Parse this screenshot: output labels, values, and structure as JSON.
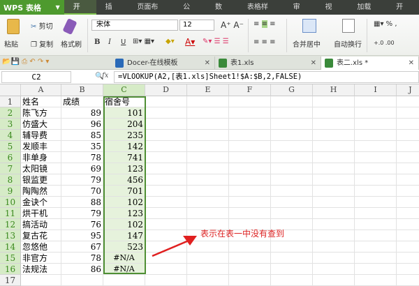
{
  "app": {
    "logo": "WPS 表格"
  },
  "menu_tabs": [
    "开始",
    "插入",
    "页面布局",
    "公式",
    "数据",
    "表格样式",
    "审阅",
    "视图",
    "加载项",
    "开发"
  ],
  "ribbon": {
    "paste": "粘贴",
    "cut": "剪切",
    "copy": "复制",
    "format_painter": "格式刷",
    "font": "宋体",
    "font_size": "12",
    "merge_center": "合并居中",
    "wrap_text": "自动换行",
    "percent": "%"
  },
  "doc_tabs": [
    {
      "label": "Docer-在线模板"
    },
    {
      "label": "表1.xls"
    },
    {
      "label": "表二.xls *"
    }
  ],
  "formula_bar": {
    "cell_ref": "C2",
    "fx": "fx",
    "formula": "=VLOOKUP(A2,[表1.xls]Sheet1!$A:$B,2,FALSE)"
  },
  "columns": [
    "A",
    "B",
    "C",
    "D",
    "E",
    "F",
    "G",
    "H",
    "I",
    "J"
  ],
  "rows": [
    [
      "姓名",
      "成绩",
      "宿舍号"
    ],
    [
      "陈飞方",
      "89",
      "101"
    ],
    [
      "仿盛大",
      "96",
      "204"
    ],
    [
      "辅导费",
      "85",
      "235"
    ],
    [
      "发顺丰",
      "35",
      "142"
    ],
    [
      "非单身",
      "78",
      "741"
    ],
    [
      "太阳镜",
      "69",
      "123"
    ],
    [
      "银监更",
      "79",
      "456"
    ],
    [
      "陶陶然",
      "70",
      "701"
    ],
    [
      "金诀个",
      "88",
      "102"
    ],
    [
      "烘干机",
      "79",
      "123"
    ],
    [
      "搞活动",
      "76",
      "102"
    ],
    [
      "复古花",
      "95",
      "147"
    ],
    [
      "忽悠他",
      "67",
      "523"
    ],
    [
      "非官方",
      "78",
      "#N/A"
    ],
    [
      "法规法",
      "86",
      "#N/A"
    ]
  ],
  "annotation": "表示在表一中没有查到",
  "colors": {
    "accent": "#4e9a2e",
    "annotation": "#dd2222"
  }
}
